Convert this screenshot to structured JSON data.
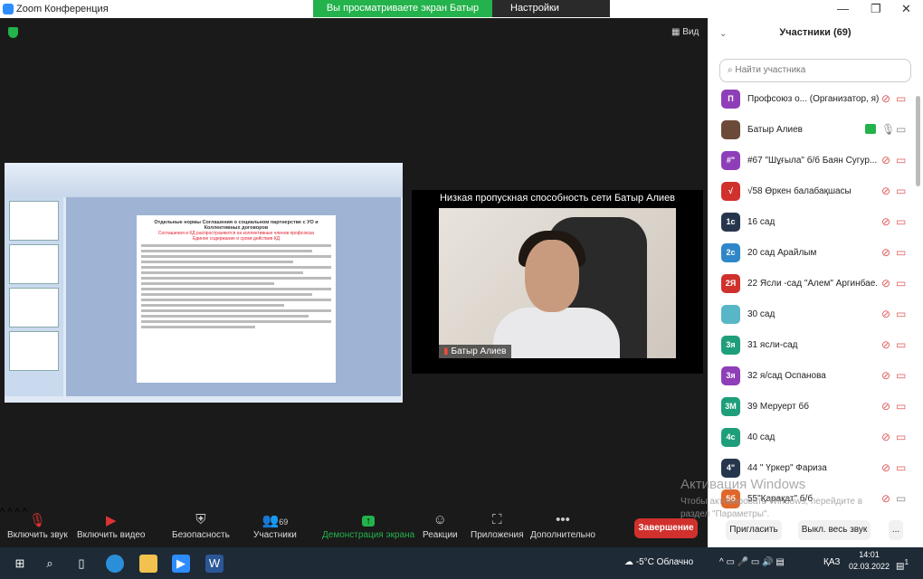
{
  "window": {
    "title": "Zoom Конференция",
    "banner": "Вы просматриваете экран Батыр Алиев",
    "view_settings": "Настройки просмотра",
    "view_label": "Вид"
  },
  "shared_slide": {
    "title": "Отдельные нормы Соглашения о социальном партнерстве с УО и Коллективных договоров",
    "red_line_1": "Соглашения и КД распространяются на коллективные членов профсоюза",
    "red_line_2": "Единое содержание и сроки действия КД"
  },
  "video": {
    "caption": "Низкая пропускная способность сети Батыр Алиев",
    "name": "Батыр Алиев"
  },
  "toolbar": {
    "unmute": "Включить звук",
    "video": "Включить видео",
    "security": "Безопасность",
    "participants": "Участники",
    "participants_count": "69",
    "share": "Демонстрация экрана",
    "reactions": "Реакции",
    "apps": "Приложения",
    "more": "Дополнительно",
    "end": "Завершение"
  },
  "panel": {
    "title": "Участники (69)",
    "search_placeholder": "Найти участника",
    "invite": "Пригласить",
    "mute_all": "Выкл. весь звук",
    "more": "...",
    "participants": [
      {
        "initials": "П",
        "name": "Профсоюз о... (Организатор, я)",
        "color": "#8e3fb8",
        "muted": true,
        "video_off": true
      },
      {
        "initials": "",
        "name": "Батыр Алиев",
        "color": "#6b4a3a",
        "muted": false,
        "video_off": false,
        "sharing": true
      },
      {
        "initials": "#\"",
        "name": "#67 \"Шұғыла\" б/б Баян Сугур...",
        "color": "#8e3fb8",
        "muted": true,
        "video_off": true
      },
      {
        "initials": "√",
        "name": "√58 Өркен балабақшасы",
        "color": "#d0312d",
        "muted": true,
        "video_off": true
      },
      {
        "initials": "1с",
        "name": "16 сад",
        "color": "#26374d",
        "muted": true,
        "video_off": true
      },
      {
        "initials": "2с",
        "name": "20 сад Арайлым",
        "color": "#2f86c8",
        "muted": true,
        "video_off": true
      },
      {
        "initials": "2Я",
        "name": "22 Ясли -сад \"Алем\" Аргинбае...",
        "color": "#d0312d",
        "muted": true,
        "video_off": true
      },
      {
        "initials": "",
        "name": "30 сад",
        "color": "#58b7c7",
        "muted": true,
        "video_off": true
      },
      {
        "initials": "3я",
        "name": "31 ясли-сад",
        "color": "#1e9e7a",
        "muted": true,
        "video_off": true
      },
      {
        "initials": "3я",
        "name": "32 я/сад Оспанова",
        "color": "#8e3fb8",
        "muted": true,
        "video_off": true
      },
      {
        "initials": "3М",
        "name": "39 Меруерт бб",
        "color": "#1e9e7a",
        "muted": true,
        "video_off": true
      },
      {
        "initials": "4с",
        "name": "40 сад",
        "color": "#1e9e7a",
        "muted": true,
        "video_off": true
      },
      {
        "initials": "4\"",
        "name": "44 \" Үркер\" Фариза",
        "color": "#26374d",
        "muted": true,
        "video_off": true
      },
      {
        "initials": "5б",
        "name": "55\"Қарақат\" б/б",
        "color": "#e0662a",
        "muted": true,
        "video_off": false
      }
    ]
  },
  "watermark": {
    "line1": "Активация Windows",
    "line2": "Чтобы активировать Windows, перейдите в раздел \"Параметры\"."
  },
  "taskbar": {
    "weather": "-5°C  Облачно",
    "lang": "ҚАЗ",
    "time": "14:01",
    "date": "02.03.2022",
    "notifications": "1"
  }
}
